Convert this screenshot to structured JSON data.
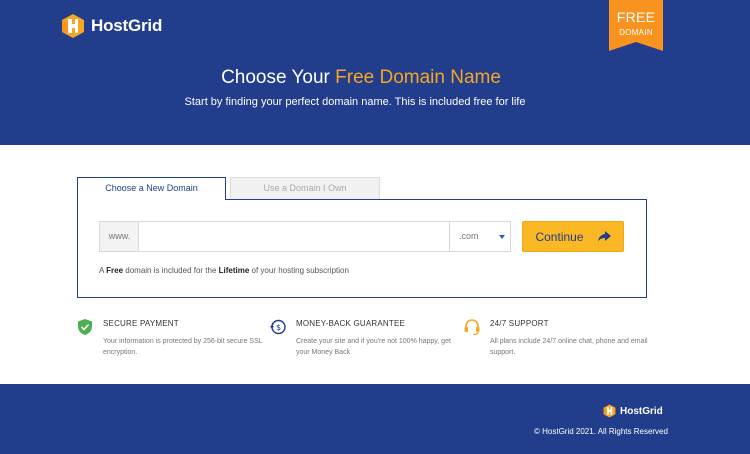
{
  "brand": {
    "name": "HostGrid"
  },
  "ribbon": {
    "line1": "FREE",
    "line2": "DOMAIN"
  },
  "hero": {
    "title_prefix": "Choose Your ",
    "title_accent": "Free Domain Name",
    "subtitle": "Start by finding your perfect domain name. This is included free for life"
  },
  "tabs": [
    {
      "label": "Choose a New Domain",
      "active": true
    },
    {
      "label": "Use a Domain I Own",
      "active": false
    }
  ],
  "search": {
    "prefix": "www.",
    "value": "",
    "tld": ".com",
    "continue_label": "Continue",
    "note_parts": [
      "A ",
      "Free",
      " domain is included for the ",
      "Lifetime",
      " of your hosting subscription"
    ]
  },
  "features": [
    {
      "icon": "shield-check-icon",
      "title": "SECURE PAYMENT",
      "text": "Your information is protected by 256-bit secure SSL encryption."
    },
    {
      "icon": "money-back-icon",
      "title": "MONEY-BACK GUARANTEE",
      "text": "Create your site and if you're not 100% happy, get your Money Back"
    },
    {
      "icon": "headset-icon",
      "title": "24/7 SUPPORT",
      "text": "All plans include 24/7 online chat, phone and email support."
    }
  ],
  "footer": {
    "brand": "HostGrid",
    "copyright": "© HostGrid 2021. All Rights Reserved"
  },
  "colors": {
    "brand_blue": "#213d8c",
    "accent_orange": "#f5a623",
    "ribbon_orange": "#f7931e",
    "button_yellow": "#fbb825",
    "feature_green": "#4caf50",
    "feature_blue": "#213d8c",
    "feature_yellow": "#f5a623"
  }
}
